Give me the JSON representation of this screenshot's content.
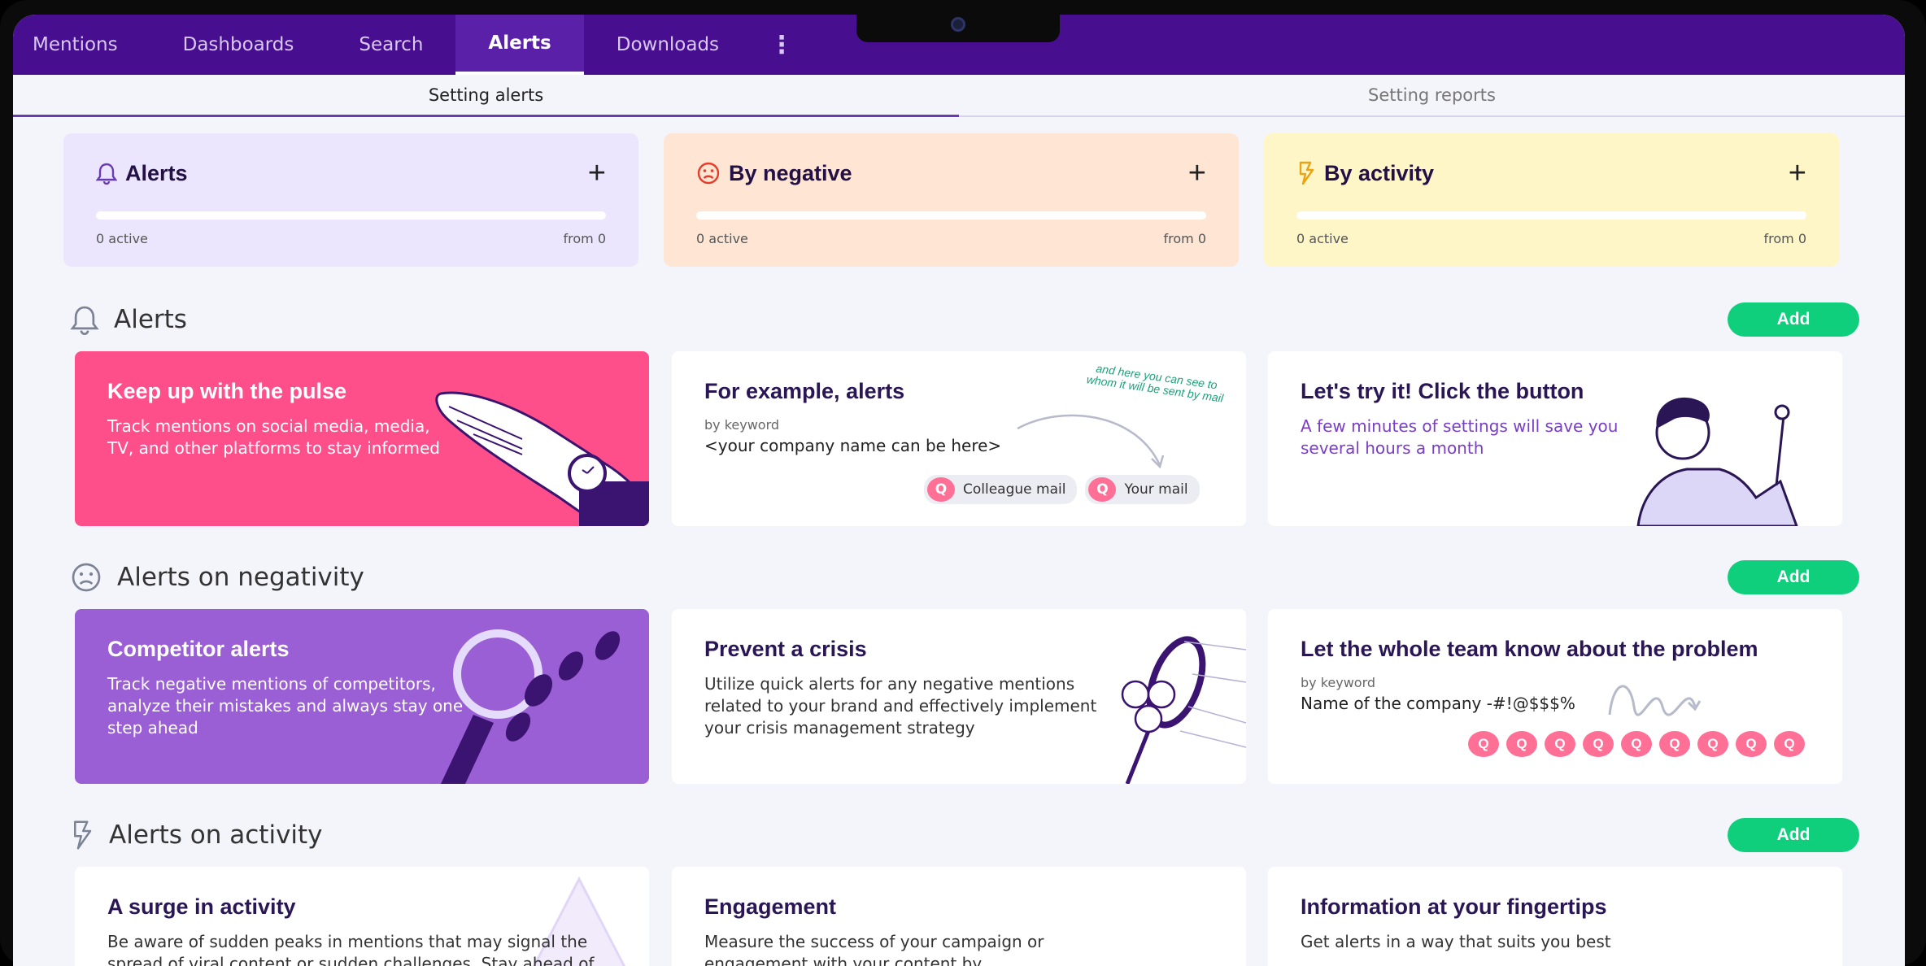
{
  "nav": {
    "tabs": [
      "Mentions",
      "Dashboards",
      "Search",
      "Alerts",
      "Downloads"
    ],
    "active": "Alerts"
  },
  "subtabs": [
    "Setting alerts",
    "Setting reports"
  ],
  "summary": [
    {
      "title": "Alerts",
      "left": "0 active",
      "right": "from 0",
      "bg": "#ebe6fd"
    },
    {
      "title": "By negative",
      "left": "0 active",
      "right": "from 0",
      "bg": "#ffe5d4"
    },
    {
      "title": "By activity",
      "left": "0 active",
      "right": "from 0",
      "bg": "#fff6c7"
    }
  ],
  "sections": {
    "alerts": {
      "title": "Alerts",
      "add": "Add",
      "cards": [
        {
          "title": "Keep up with the pulse",
          "desc": "Track mentions on social media, media, TV, and other platforms to stay informed"
        },
        {
          "title": "For example, alerts",
          "small": "by keyword",
          "value": "<your company name can be here>",
          "note": "and here you can see to whom it will be sent by mail",
          "chip1": "Colleague mail",
          "chip2": "Your mail",
          "q": "Q"
        },
        {
          "title": "Let's try it! Click the button",
          "desc": "A few minutes of settings will save you several hours a month"
        }
      ]
    },
    "negativity": {
      "title": "Alerts on negativity",
      "add": "Add",
      "cards": [
        {
          "title": "Competitor alerts",
          "desc": "Track negative mentions of competitors, analyze their mistakes and always stay one step ahead"
        },
        {
          "title": "Prevent a crisis",
          "desc": "Utilize quick alerts for any negative mentions related to your brand and effectively implement your crisis management strategy"
        },
        {
          "title": "Let the whole team know about the problem",
          "small": "by keyword",
          "value": "Name of the company -#!@$$$%",
          "q": "Q"
        }
      ]
    },
    "activity": {
      "title": "Alerts on activity",
      "add": "Add",
      "cards": [
        {
          "title": "A surge in activity",
          "desc": "Be aware of sudden peaks in mentions that may signal the spread of viral content or sudden challenges. Stay ahead of"
        },
        {
          "title": "Engagement",
          "desc": "Measure the success of your campaign or engagement with your content by"
        },
        {
          "title": "Information at your fingertips",
          "desc": "Get alerts in a way that suits you best"
        }
      ]
    }
  },
  "colors": {
    "nav": "#470f8f",
    "add": "#0fcf7c",
    "pink": "#ff4f8a",
    "purple": "#9a5fd4"
  }
}
